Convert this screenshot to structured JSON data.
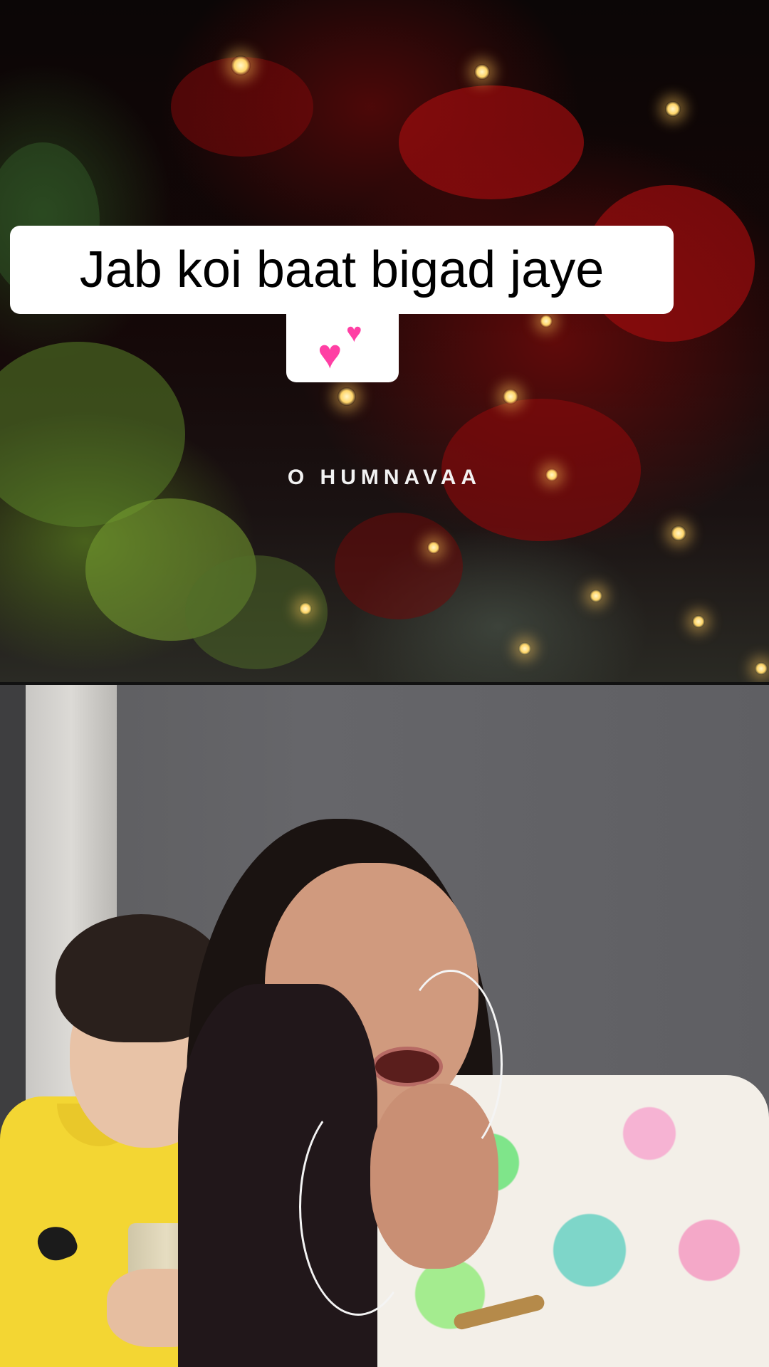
{
  "caption": {
    "line1": "Jab koi baat bigad jaye",
    "line2_icon": "two-hearts-icon",
    "background_color": "#ffffff",
    "text_color": "#000000",
    "heart_color": "#ff3fa4"
  },
  "video_top": {
    "song_text": "O HUMNAVAA"
  },
  "video_bottom": {
    "description_icon": "camera-feed"
  }
}
